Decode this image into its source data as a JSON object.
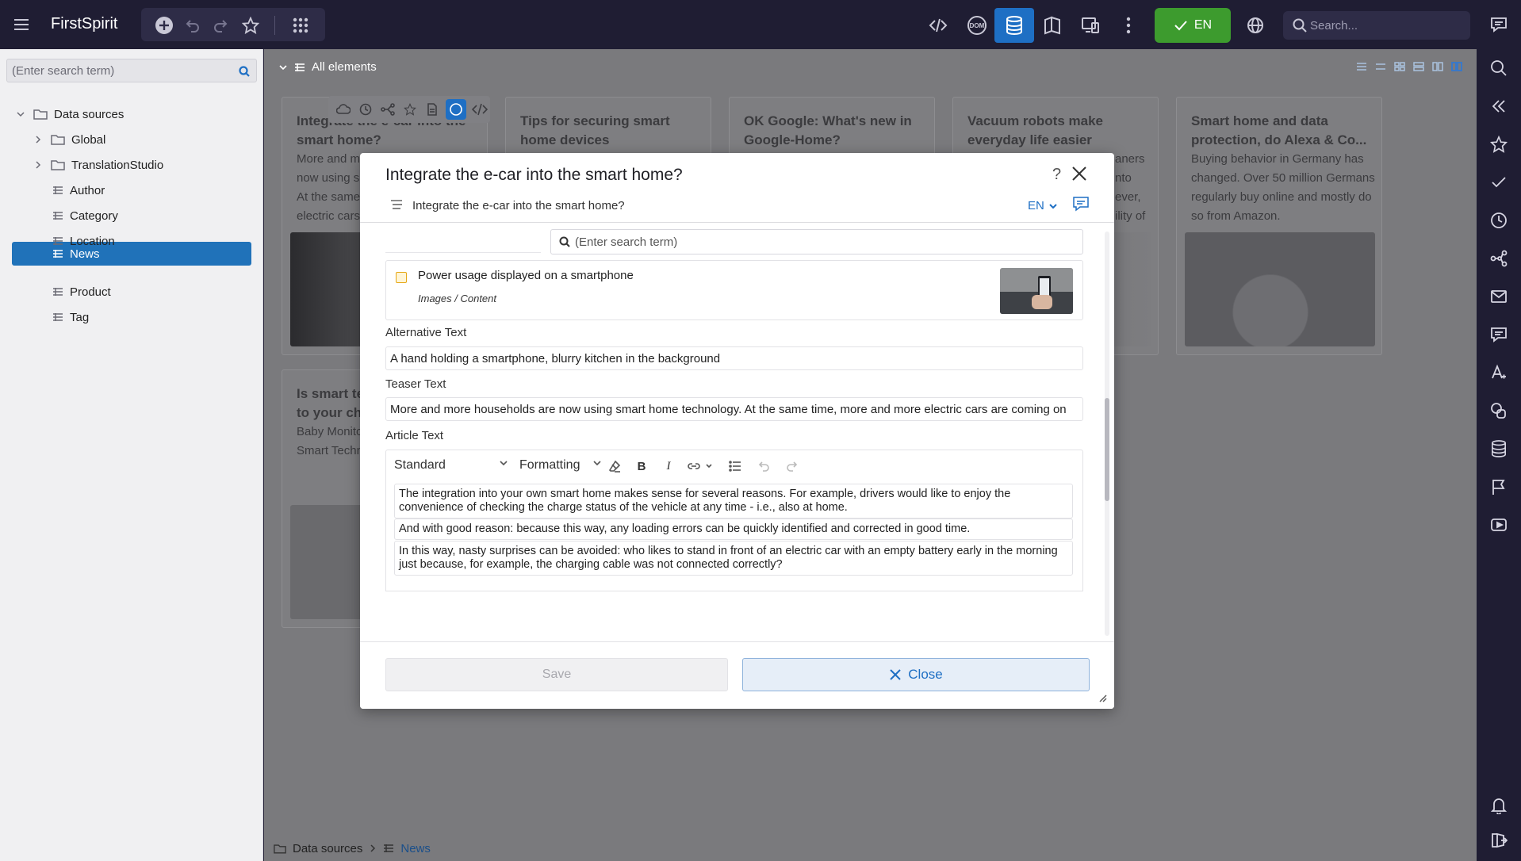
{
  "app": {
    "brand": "FirstSpirit",
    "language": "EN",
    "search_placeholder": "Search..."
  },
  "sidebar": {
    "search_placeholder": "(Enter search term)",
    "root": "Data sources",
    "folders": [
      "Global",
      "TranslationStudio"
    ],
    "tables": [
      "Author",
      "Category",
      "Location",
      "News",
      "Product",
      "Tag"
    ],
    "selected": "News"
  },
  "main": {
    "header": "All elements",
    "cards": [
      {
        "title": "Integrate the e-car into the smart home?",
        "text": "More and more households are now using smart home technology. At the same time, more and more electric cars"
      },
      {
        "title": "Tips for securing smart home devices",
        "text": ""
      },
      {
        "title": "OK Google: What's new in Google-Home?",
        "text": ""
      },
      {
        "title": "Vacuum robots make everyday life easier",
        "text": "aners nto ever, ility of"
      },
      {
        "title": "Smart home and data protection, do Alexa & Co...",
        "text": "Buying behavior in Germany has changed. Over 50 million Germans regularly buy online and mostly do so from Amazon."
      },
      {
        "title": "Is smart technology suitable to your child",
        "text": "Baby Monitors of Smart Devices of Smart Technology"
      }
    ]
  },
  "breadcrumb": [
    "Data sources",
    "News"
  ],
  "modal": {
    "title": "Integrate the e-car into the smart home?",
    "help": "?",
    "subtitle": "Integrate the e-car into the smart home?",
    "language": "EN",
    "ref_search_placeholder": "(Enter search term)",
    "ref_item": {
      "title": "Power usage displayed on a smartphone",
      "path": "Images / Content"
    },
    "alt_text_label": "Alternative Text",
    "alt_text_value": "A hand holding a smartphone, blurry kitchen in the background",
    "teaser_label": "Teaser Text",
    "teaser_value": "More and more households are now using smart home technology. At the same time, more and more electric cars are coming on",
    "article_label": "Article Text",
    "rte": {
      "style": "Standard",
      "formatting": "Formatting",
      "bold": "B",
      "italic": "I",
      "paragraphs": [
        "The integration into your own smart home makes sense for several reasons. For example, drivers would like to enjoy the convenience of checking the charge status of the vehicle at any time - i.e., also at home.",
        "And with good reason: because this way, any loading errors can be quickly identified and corrected in good time.",
        "In this way, nasty surprises can be avoided: who likes to stand in front of an electric car with an empty battery early in the morning just because, for example, the charging cable was not connected correctly?"
      ]
    },
    "save_label": "Save",
    "close_label": "Close"
  }
}
